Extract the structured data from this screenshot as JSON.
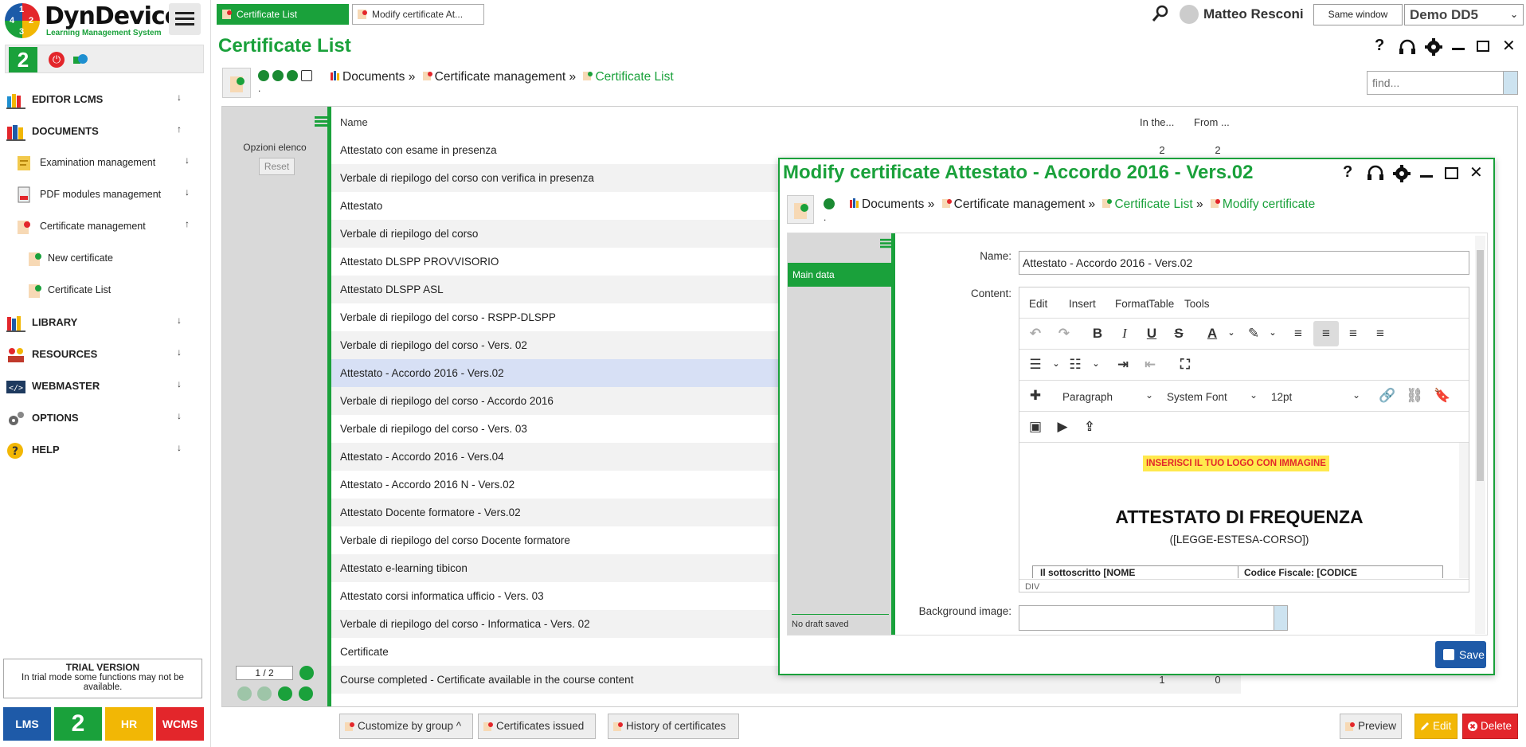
{
  "sidebar": {
    "logo_text": "DynDevice",
    "logo_sub": "Learning Management System",
    "logo_digits": [
      "1",
      "2",
      "3",
      "4"
    ],
    "status_badge": "2",
    "items": [
      {
        "label": "EDITOR LCMS",
        "arrow": "↓"
      },
      {
        "label": "DOCUMENTS",
        "arrow": "↑"
      },
      {
        "label": "LIBRARY",
        "arrow": "↓"
      },
      {
        "label": "RESOURCES",
        "arrow": "↓"
      },
      {
        "label": "WEBMASTER",
        "arrow": "↓"
      },
      {
        "label": "OPTIONS",
        "arrow": "↓"
      },
      {
        "label": "HELP",
        "arrow": "↓"
      }
    ],
    "documents_children": [
      {
        "label": "Examination management",
        "arrow": "↓"
      },
      {
        "label": "PDF modules management",
        "arrow": "↓"
      },
      {
        "label": "Certificate management",
        "arrow": "↑"
      }
    ],
    "certificate_children": [
      {
        "label": "New certificate"
      },
      {
        "label": "Certificate List"
      }
    ],
    "trial": {
      "title": "TRIAL VERSION",
      "text": "In trial mode some functions may not be available."
    },
    "tiles": [
      {
        "label": "LMS",
        "color": "#1e5aa8"
      },
      {
        "label": "2",
        "color": "#1aa13b"
      },
      {
        "label": "HR",
        "color": "#f2b705"
      },
      {
        "label": "WCMS",
        "color": "#e3262b"
      }
    ]
  },
  "topbar": {
    "tabs": [
      {
        "label": "Certificate List",
        "active": true
      },
      {
        "label": "Modify certificate At...",
        "active": false
      }
    ],
    "user_name": "Matteo Resconi",
    "same_window": "Same window",
    "demo_select": "Demo DD5"
  },
  "main": {
    "title": "Certificate List",
    "breadcrumb": [
      "Documents",
      "Certificate management",
      "Certificate List"
    ],
    "breadcrumb_sep": "»",
    "dot_below": ".",
    "find_placeholder": "find...",
    "list_options": "Opzioni elenco",
    "reset": "Reset",
    "columns": [
      "Name",
      "In the...",
      "From ..."
    ],
    "rows": [
      {
        "name": "Attestato con esame in presenza",
        "c1": "2",
        "c2": "2"
      },
      {
        "name": "Verbale di riepilogo del corso con verifica in presenza",
        "c1": "",
        "c2": ""
      },
      {
        "name": "Attestato",
        "c1": "",
        "c2": ""
      },
      {
        "name": "Verbale di riepilogo del corso",
        "c1": "",
        "c2": ""
      },
      {
        "name": "Attestato DLSPP PROVVISORIO",
        "c1": "",
        "c2": ""
      },
      {
        "name": "Attestato DLSPP ASL",
        "c1": "",
        "c2": ""
      },
      {
        "name": "Verbale di riepilogo del corso - RSPP-DLSPP",
        "c1": "",
        "c2": ""
      },
      {
        "name": "Verbale di riepilogo del corso - Vers. 02",
        "c1": "",
        "c2": ""
      },
      {
        "name": "Attestato - Accordo 2016 - Vers.02",
        "c1": "",
        "c2": ""
      },
      {
        "name": "Verbale di riepilogo del corso - Accordo 2016",
        "c1": "",
        "c2": ""
      },
      {
        "name": "Verbale di riepilogo del corso - Vers. 03",
        "c1": "",
        "c2": ""
      },
      {
        "name": "Attestato - Accordo 2016 - Vers.04",
        "c1": "",
        "c2": ""
      },
      {
        "name": "Attestato - Accordo 2016 N - Vers.02",
        "c1": "",
        "c2": ""
      },
      {
        "name": "Attestato Docente formatore - Vers.02",
        "c1": "",
        "c2": ""
      },
      {
        "name": "Verbale di riepilogo del corso Docente formatore",
        "c1": "",
        "c2": ""
      },
      {
        "name": "Attestato e-learning tibicon",
        "c1": "",
        "c2": ""
      },
      {
        "name": "Attestato corsi informatica ufficio - Vers. 03",
        "c1": "",
        "c2": ""
      },
      {
        "name": "Verbale di riepilogo del corso - Informatica - Vers. 02",
        "c1": "",
        "c2": ""
      },
      {
        "name": "Certificate",
        "c1": "",
        "c2": ""
      },
      {
        "name": "Course completed - Certificate available in the course content",
        "c1": "1",
        "c2": "0"
      }
    ],
    "selected_row": 8,
    "pager": "1 / 2",
    "bottom_left_buttons": [
      "Customize by group ^",
      "Certificates issued",
      "History of certificates"
    ],
    "bottom_right_buttons": [
      "Preview",
      "Edit",
      "Delete"
    ]
  },
  "modal": {
    "title": "Modify certificate Attestato - Accordo 2016 - Vers.02",
    "breadcrumb": [
      "Documents",
      "Certificate management",
      "Certificate List",
      "Modify certificate"
    ],
    "dot_below": ".",
    "side_tab": "Main data",
    "no_draft": "No draft saved",
    "labels": {
      "name": "Name:",
      "content": "Content:",
      "background": "Background image:"
    },
    "name_value": "Attestato - Accordo 2016 - Vers.02",
    "menu": [
      "Edit",
      "Insert",
      "Format",
      "Table",
      "Tools"
    ],
    "format": {
      "block": "Paragraph",
      "font": "System Font",
      "size": "12pt"
    },
    "content": {
      "logo_tag": "INSERISCI IL TUO LOGO CON IMMAGINE",
      "heading": "ATTESTATO DI FREQUENZA",
      "sub": "([LEGGE-ESTESA-CORSO])",
      "cell_left": "Il sottoscritto  [NOME",
      "cell_right": "Codice Fiscale: [CODICE"
    },
    "status_path": "DIV",
    "save": "Save"
  }
}
